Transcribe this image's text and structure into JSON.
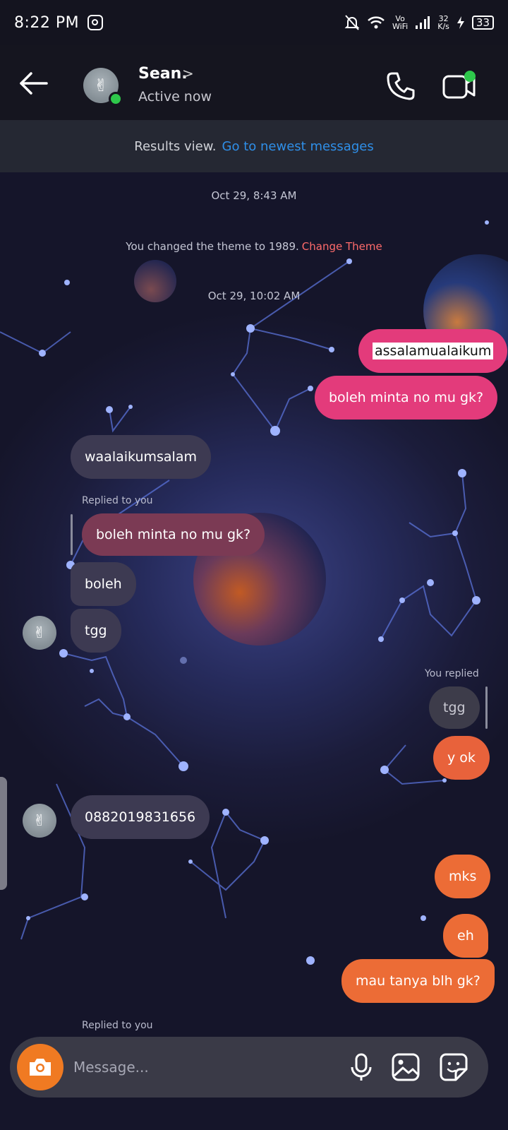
{
  "status_bar": {
    "time": "8:22 PM",
    "net_top": "Vo",
    "net_bottom": "WiFi",
    "speed_top": "32",
    "speed_bottom": "K/s",
    "battery": "33",
    "icons": [
      "instagram-icon",
      "mute-bell-icon",
      "wifi-icon",
      "signal-icon",
      "charging-icon",
      "battery-icon"
    ]
  },
  "header": {
    "name": "Sean.",
    "chevron": ">",
    "status": "Active now",
    "online_color": "#2ec84b",
    "icons": [
      "back-arrow-icon",
      "phone-icon",
      "video-call-icon"
    ]
  },
  "banner": {
    "text": "Results view.",
    "link": "Go to newest messages",
    "link_color": "#2f8fe8"
  },
  "messages": {
    "timestamp1": "Oct 29, 8:43 AM",
    "theme_note": "You changed the theme to 1989.",
    "theme_link": "Change Theme",
    "timestamp2": "Oct 29, 10:02 AM",
    "m1": "assalamualaikum",
    "m2": "boleh minta no mu gk?",
    "m3": "waalaikumsalam",
    "reply_label_1": "Replied to you",
    "m4_quote": "boleh minta no mu gk?",
    "m5": "boleh",
    "m6": "tgg",
    "reply_label_2": "You replied",
    "m7_quote": "tgg",
    "m8": "y ok",
    "m9": "0882019831656",
    "m10": "mks",
    "m11": "eh",
    "m12": "mau tanya blh gk?",
    "reply_label_3": "Replied to you"
  },
  "colors": {
    "outgoing_pink": "#e33b7b",
    "outgoing_orange": "#e8623b",
    "incoming": "#3d3a52"
  },
  "composer": {
    "placeholder": "Message...",
    "icons": [
      "camera-icon",
      "microphone-icon",
      "gallery-icon",
      "sticker-icon"
    ]
  }
}
